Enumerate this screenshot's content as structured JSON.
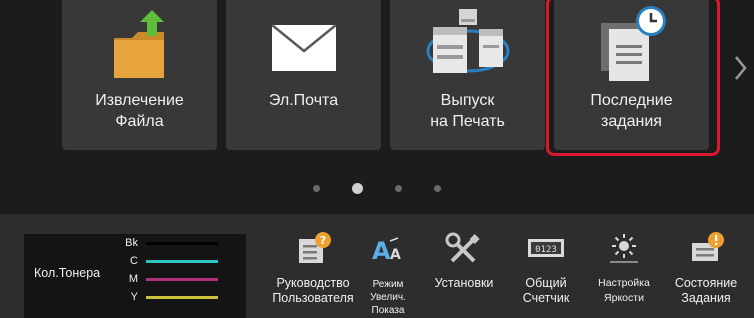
{
  "tiles": [
    {
      "label_line1": "Извлечение",
      "label_line2": "Файла",
      "icon": "folder-upload-icon"
    },
    {
      "label_line1": "Эл.Почта",
      "label_line2": "",
      "icon": "envelope-icon"
    },
    {
      "label_line1": "Выпуск",
      "label_line2": "на Печать",
      "icon": "print-release-icon"
    },
    {
      "label_line1": "Последние",
      "label_line2": "задания",
      "icon": "recent-jobs-icon"
    }
  ],
  "pagination": {
    "count": 4,
    "active": 2
  },
  "toner": {
    "title": "Кол.Тонера",
    "rows": [
      {
        "code": "Bk",
        "color": "#000000",
        "level": 1.0
      },
      {
        "code": "C",
        "color": "#2ec4c4",
        "level": 1.0
      },
      {
        "code": "M",
        "color": "#b0307a",
        "level": 1.0
      },
      {
        "code": "Y",
        "color": "#c9c23a",
        "level": 1.0
      }
    ]
  },
  "bottom_buttons": [
    {
      "label_line1": "Руководство",
      "label_line2": "Пользователя",
      "label_line3": "",
      "icon": "user-guide-icon"
    },
    {
      "label_line1": "Режим",
      "label_line2": "Увелич.",
      "label_line3": "Показа",
      "icon": "enlarge-display-icon"
    },
    {
      "label_line1": "Установки",
      "label_line2": "",
      "label_line3": "",
      "icon": "settings-tools-icon"
    },
    {
      "label_line1": "Общий",
      "label_line2": "Счетчик",
      "label_line3": "",
      "icon": "counter-icon",
      "counter_text": "0123"
    },
    {
      "label_line1": "Настройка",
      "label_line2": "Яркости",
      "label_line3": "",
      "icon": "brightness-icon"
    },
    {
      "label_line1": "Состояние",
      "label_line2": "Задания",
      "label_line3": "",
      "icon": "job-status-icon"
    }
  ],
  "colors": {
    "highlight": "#d8182c",
    "folder": "#e7a43c",
    "arrow_green": "#5fbf3a",
    "badge_orange": "#f0a030"
  }
}
